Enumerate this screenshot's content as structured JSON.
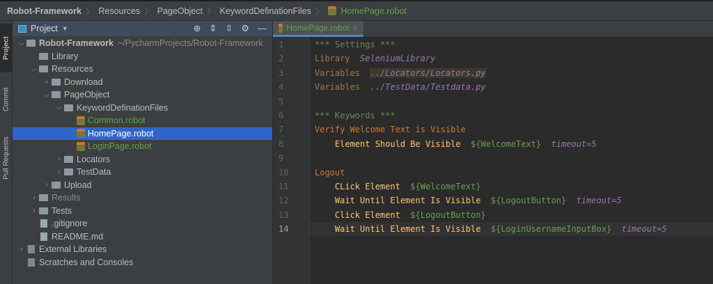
{
  "breadcrumb": [
    "Robot-Framework",
    "Resources",
    "PageObject",
    "KeywordDefinationFiles",
    "HomePage.robot"
  ],
  "sidebar_tabs": [
    "Project",
    "Commit",
    "Pull Requests"
  ],
  "panel": {
    "title": "Project"
  },
  "tree": [
    {
      "label": "Robot-Framework",
      "hint": "~/PycharmProjects/Robot-Framework",
      "depth": 0,
      "arrow": "v",
      "type": "folder"
    },
    {
      "label": "Library",
      "depth": 1,
      "arrow": "",
      "type": "folder"
    },
    {
      "label": "Resources",
      "depth": 1,
      "arrow": "v",
      "type": "folder"
    },
    {
      "label": "Download",
      "depth": 2,
      "arrow": ">",
      "type": "folder"
    },
    {
      "label": "PageObject",
      "depth": 2,
      "arrow": "v",
      "type": "folder"
    },
    {
      "label": "KeywordDefinationFiles",
      "depth": 3,
      "arrow": "v",
      "type": "folder"
    },
    {
      "label": "Common.robot",
      "depth": 4,
      "arrow": "",
      "type": "robot"
    },
    {
      "label": "HomePage.robot",
      "depth": 4,
      "arrow": "",
      "type": "robot",
      "selected": true
    },
    {
      "label": "LoginPage.robot",
      "depth": 4,
      "arrow": "",
      "type": "robot"
    },
    {
      "label": "Locators",
      "depth": 3,
      "arrow": ">",
      "type": "folder"
    },
    {
      "label": "TestData",
      "depth": 3,
      "arrow": ">",
      "type": "folder"
    },
    {
      "label": "Upload",
      "depth": 2,
      "arrow": ">",
      "type": "folder"
    },
    {
      "label": "Results",
      "depth": 1,
      "arrow": ">",
      "type": "folder",
      "dim": true
    },
    {
      "label": "Tests",
      "depth": 1,
      "arrow": ">",
      "type": "folder"
    },
    {
      "label": ".gitignore",
      "depth": 1,
      "arrow": "",
      "type": "file"
    },
    {
      "label": "README.md",
      "depth": 1,
      "arrow": "",
      "type": "file"
    },
    {
      "label": "External Libraries",
      "depth": 0,
      "arrow": ">",
      "type": "lib"
    },
    {
      "label": "Scratches and Consoles",
      "depth": 0,
      "arrow": "",
      "type": "lib"
    }
  ],
  "editor_tab": "HomePage.robot",
  "current_line": 14,
  "code": [
    [
      [
        "sec",
        "*** Settings ***"
      ]
    ],
    [
      [
        "set",
        "Library  "
      ],
      [
        "lib",
        "SeleniumLibrary"
      ]
    ],
    [
      [
        "set",
        "Variables  "
      ],
      [
        "lib hl",
        "../Locators/Locators.py"
      ]
    ],
    [
      [
        "set",
        "Variables  "
      ],
      [
        "lib",
        "../TestData/Testdata.py"
      ]
    ],
    [],
    [
      [
        "sec",
        "*** Keywords ***"
      ]
    ],
    [
      [
        "kw",
        "Verify Welcome Text is Visible"
      ]
    ],
    [
      [
        "call",
        "    Element Should Be Visible  "
      ],
      [
        "var",
        "${WelcomeText}"
      ],
      [
        "arg",
        "  timeout=5"
      ]
    ],
    [],
    [
      [
        "kw",
        "Logout"
      ]
    ],
    [
      [
        "call",
        "    CLick Element  "
      ],
      [
        "var",
        "${WelcomeText}"
      ]
    ],
    [
      [
        "call",
        "    Wait Until Element Is Visible  "
      ],
      [
        "var",
        "${LogoutButton}"
      ],
      [
        "arg",
        "  timeout=5"
      ]
    ],
    [
      [
        "call",
        "    Click Element  "
      ],
      [
        "var",
        "${LogoutButton}"
      ]
    ],
    [
      [
        "call",
        "    Wait Until Element Is Visible  "
      ],
      [
        "var",
        "${LoginUsernameInputBox}"
      ],
      [
        "arg",
        "  timeout=5"
      ]
    ]
  ]
}
